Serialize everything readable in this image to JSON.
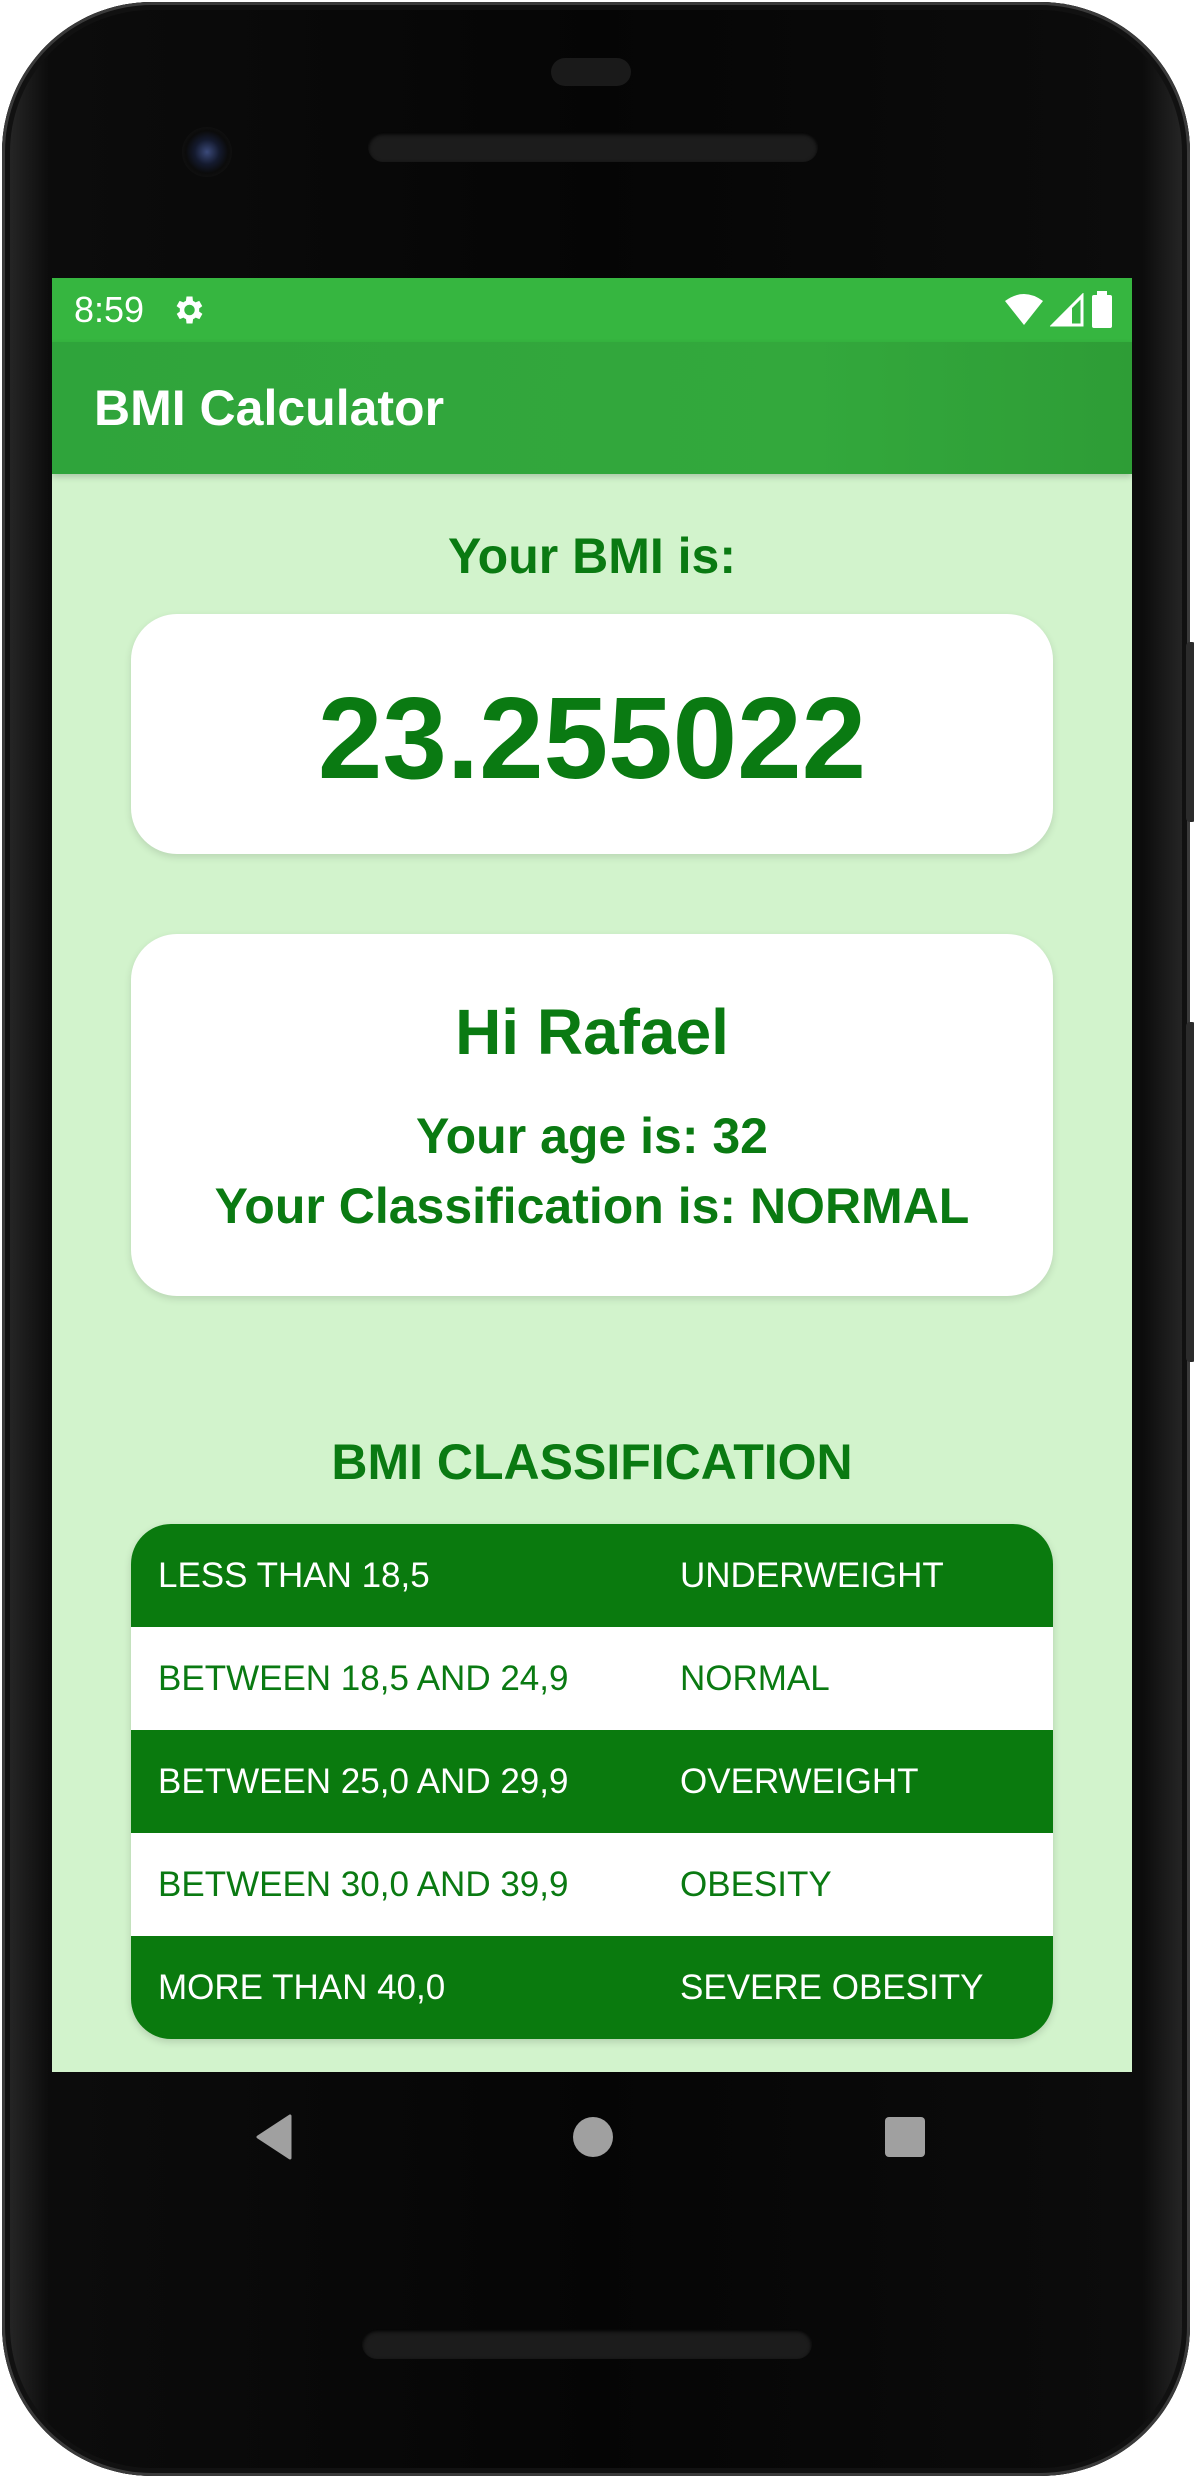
{
  "status_bar": {
    "time": "8:59",
    "icons": [
      "settings-icon",
      "wifi-icon",
      "cellular-icon",
      "battery-icon"
    ]
  },
  "app_bar": {
    "title": "BMI Calculator"
  },
  "result": {
    "heading": "Your BMI is:",
    "bmi_value": "23.255022"
  },
  "greeting_card": {
    "greeting": "Hi Rafael",
    "age_line": "Your age is: 32",
    "classification_line": "Your Classification is: NORMAL"
  },
  "classification_table": {
    "heading": "BMI CLASSIFICATION",
    "rows": [
      {
        "range": "LESS THAN 18,5",
        "label": "UNDERWEIGHT"
      },
      {
        "range": "BETWEEN 18,5 AND 24,9",
        "label": "NORMAL"
      },
      {
        "range": "BETWEEN 25,0 AND 29,9",
        "label": "OVERWEIGHT"
      },
      {
        "range": "BETWEEN 30,0 AND 39,9",
        "label": "OBESITY"
      },
      {
        "range": "MORE THAN 40,0",
        "label": "SEVERE OBESITY"
      }
    ]
  },
  "navigation": {
    "icons": [
      "back-icon",
      "home-icon",
      "recents-icon"
    ]
  },
  "colors": {
    "status_bar": "#36b640",
    "app_bar": "#33a83c",
    "background": "#d2f3cc",
    "primary_text": "#0a7a12",
    "table_dark_row": "#0a7a0e"
  }
}
